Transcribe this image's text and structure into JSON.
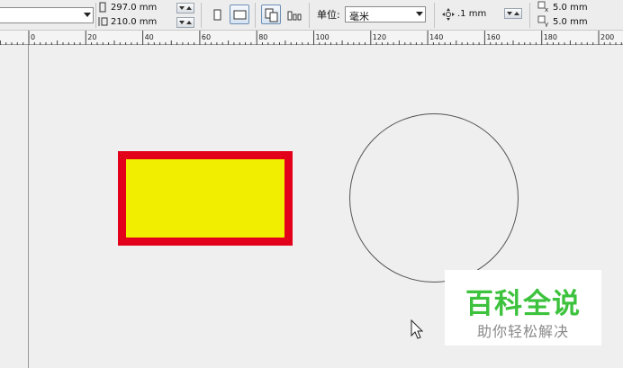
{
  "toolbar": {
    "page_width": "297.0 mm",
    "page_height": "210.0 mm",
    "units_label": "单位:",
    "units_value": "毫米",
    "nudge_value": ".1 mm",
    "duplicate_x": "5.0 mm",
    "duplicate_y": "5.0 mm"
  },
  "ruler": {
    "labels": [
      "0",
      "20",
      "40",
      "60",
      "80",
      "100",
      "120",
      "140",
      "160",
      "180",
      "200"
    ]
  },
  "watermark": {
    "title": "百科全说",
    "subtitle": "助你轻松解决"
  },
  "colors": {
    "rect_fill": "#f1ee00",
    "rect_outline": "#e3001b",
    "watermark_green": "#3cc23c"
  }
}
